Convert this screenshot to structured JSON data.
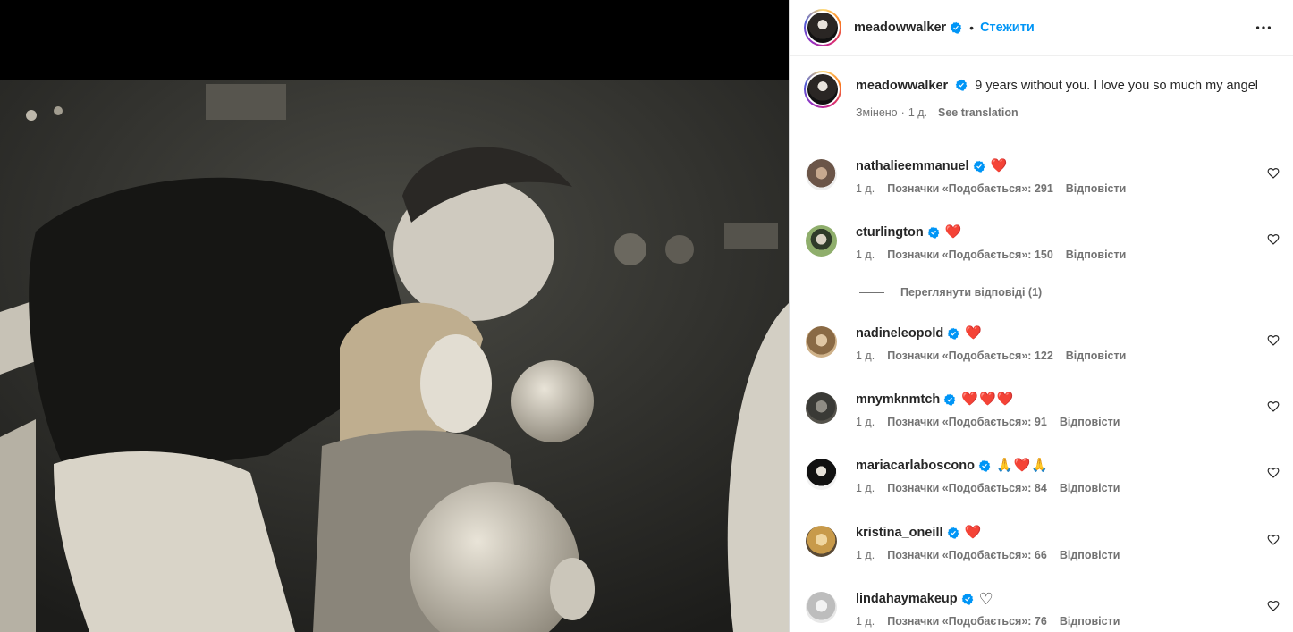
{
  "post": {
    "author": "meadowwalker",
    "follow_label": "Стежити",
    "separator": "•",
    "caption": "9 years without you. I love you so much my angel",
    "edited_label": "Змінено",
    "time_sep": "·",
    "time": "1 д.",
    "see_translation": "See translation"
  },
  "comments": [
    {
      "user": "nathalieemmanuel",
      "text": "❤️",
      "time": "1 д.",
      "likes": "Позначки «Подобається»: 291",
      "reply": "Відповісти",
      "avatar_color": "#6b5548"
    },
    {
      "user": "cturlington",
      "text": "❤️",
      "time": "1 д.",
      "likes": "Позначки «Подобається»: 150",
      "reply": "Відповісти",
      "avatar_color": "#7a8c5a"
    },
    {
      "user": "nadineleopold",
      "text": "❤️",
      "time": "1 д.",
      "likes": "Позначки «Подобається»: 122",
      "reply": "Відповісти",
      "avatar_color": "#b08a5c"
    },
    {
      "user": "mnymknmtch",
      "text": "❤️❤️❤️",
      "time": "1 д.",
      "likes": "Позначки «Подобається»: 91",
      "reply": "Відповісти",
      "avatar_color": "#3a3a36"
    },
    {
      "user": "mariacarlaboscono",
      "text": "🙏❤️🙏",
      "time": "1 д.",
      "likes": "Позначки «Подобається»: 84",
      "reply": "Відповісти",
      "avatar_color": "#222222"
    },
    {
      "user": "kristina_oneill",
      "text": "❤️",
      "time": "1 д.",
      "likes": "Позначки «Подобається»: 66",
      "reply": "Відповісти",
      "avatar_color": "#c89a4a"
    },
    {
      "user": "lindahaymakeup",
      "text": "♡",
      "time": "1 д.",
      "likes": "Позначки «Подобається»: 76",
      "reply": "Відповісти",
      "avatar_color": "#d8d8d8"
    }
  ],
  "view_replies": "Переглянути відповіді (1)",
  "colors": {
    "link": "#0095f6",
    "verified": "#0095f6",
    "muted": "#737373",
    "heart": "#ed1c24"
  },
  "icons": {
    "more": "more-horizontal-icon",
    "verified": "verified-badge-icon",
    "like": "heart-outline-icon"
  }
}
